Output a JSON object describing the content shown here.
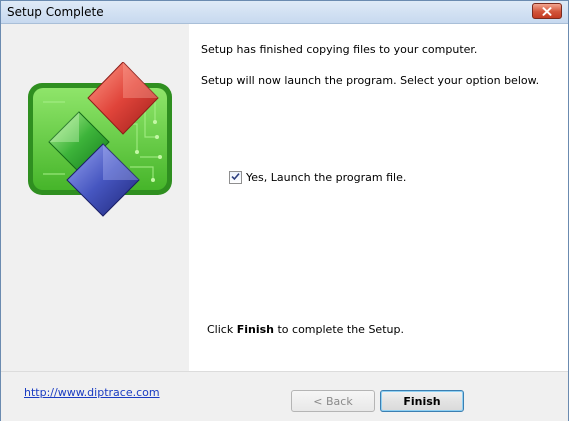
{
  "window": {
    "title": "Setup Complete"
  },
  "content": {
    "line1": "Setup has finished copying files to your computer.",
    "line2": "Setup will now launch the program. Select your option below.",
    "checkbox_label": "Yes, Launch the program file.",
    "checkbox_checked": true,
    "finish_prefix": "Click ",
    "finish_bold": "Finish",
    "finish_suffix": " to complete the Setup."
  },
  "footer": {
    "link_text": "http://www.diptrace.com",
    "back_label": "< Back",
    "finish_label": "Finish"
  },
  "icons": {
    "close": "close-icon",
    "logo": "diptrace-logo-icon",
    "check": "checkmark-icon"
  },
  "colors": {
    "close_button": "#d2543a",
    "link": "#1a3cc2",
    "logo_green": "#4fc23a",
    "logo_red": "#d83a34",
    "logo_blue": "#3f4fb5"
  }
}
